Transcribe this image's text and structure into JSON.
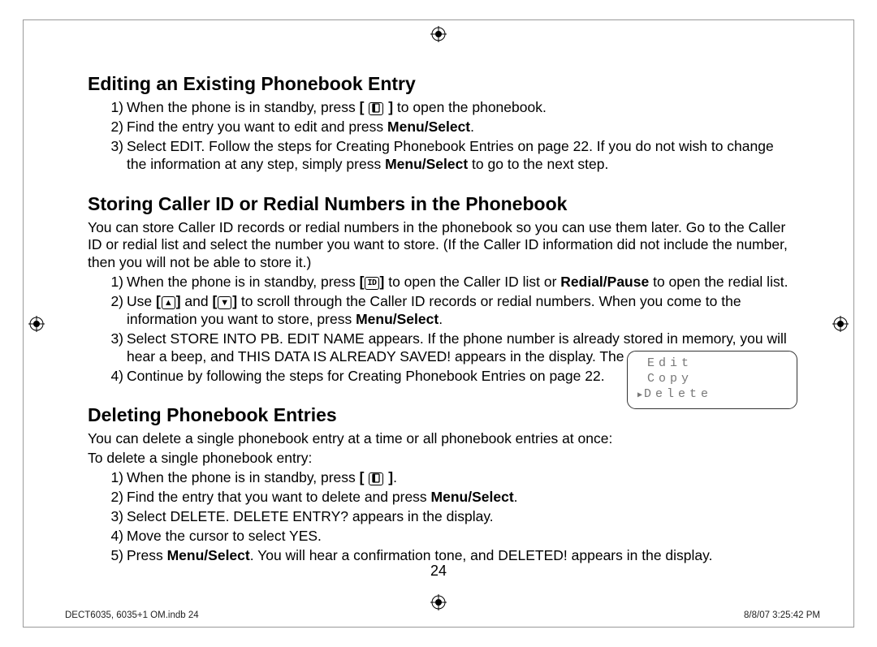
{
  "page_number": "24",
  "footer": {
    "left": "DECT6035, 6035+1 OM.indb   24",
    "right": "8/8/07   3:25:42 PM"
  },
  "icons": {
    "phonebook": "phonebook-icon",
    "cid": "ID",
    "up": "▲",
    "down": "▼"
  },
  "lcd": {
    "line1": "Edit",
    "line2": "Copy",
    "line3": "Delete"
  },
  "s1": {
    "heading": "Editing an Existing Phonebook Entry",
    "i1a": "When the phone is in standby, press ",
    "i1b": " to open the phonebook.",
    "i2a": "Find the entry you want to edit and press ",
    "i2b": "Menu/Select",
    "i2c": ".",
    "i3a": "Select EDIT. Follow the steps for Creating Phonebook Entries on page 22. If you do not wish to change the information at any step, simply press ",
    "i3b": "Menu/Select",
    "i3c": " to go to the next step."
  },
  "s2": {
    "heading": "Storing Caller ID or Redial Numbers in the Phonebook",
    "intro": "You can store Caller ID records or redial numbers in the phonebook so you can use them later. Go to the Caller ID or redial list and select the number you want to store. (If the Caller ID information did not include the number, then you will not be able to store it.)",
    "i1a": "When the phone is in standby, press ",
    "i1b": " to open the Caller ID list or ",
    "i1c": "Redial/Pause",
    "i1d": " to open the redial list.",
    "i2a": "Use ",
    "i2b": " and ",
    "i2c": "  to scroll through the Caller ID records or redial numbers. When you come to the information you want to store, press ",
    "i2d": "Menu/Select",
    "i2e": ".",
    "i3": "Select STORE INTO PB. EDIT NAME appears. If the phone number is already stored in memory, you will hear a beep, and THIS DATA IS ALREADY SAVED! appears in the display. The number will not be stored.",
    "i4": "Continue by following the steps for Creating Phonebook Entries on page 22."
  },
  "s3": {
    "heading": "Deleting Phonebook Entries",
    "intro": "You can delete a single phonebook entry at a time or all phonebook entries at once:",
    "sub": "To delete a single phonebook entry:",
    "i1a": "When the phone is in standby, press ",
    "i1b": ".",
    "i2a": "Find the entry that you want to delete and press ",
    "i2b": "Menu/Select",
    "i2c": ".",
    "i3": "Select DELETE. DELETE ENTRY? appears in the display.",
    "i4": "Move the cursor to select YES.",
    "i5a": "Press ",
    "i5b": "Menu/Select",
    "i5c": ". You will hear a confirmation tone, and DELETED! appears in the display."
  },
  "nums": {
    "n1": "1)",
    "n2": "2)",
    "n3": "3)",
    "n4": "4)",
    "n5": "5)"
  },
  "brackets": {
    "open": "[ ",
    "close": " ]"
  }
}
